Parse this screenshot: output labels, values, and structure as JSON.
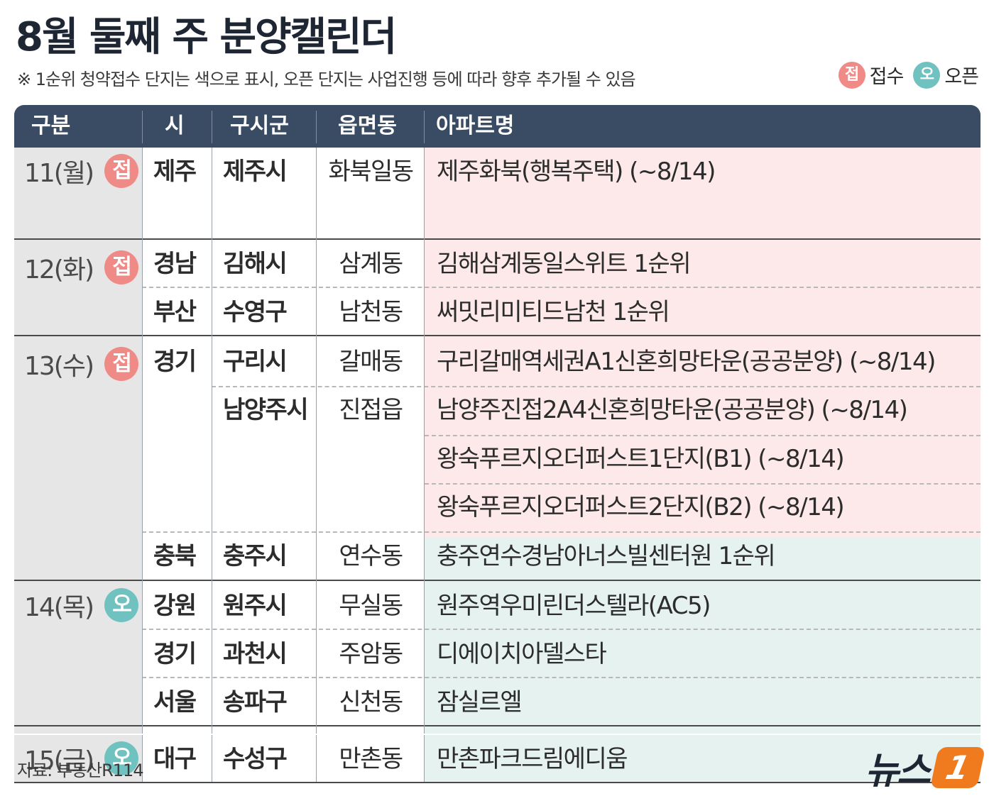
{
  "title": "8월 둘째 주 분양캘린더",
  "note": "※ 1순위 청약접수 단지는 색으로  표시, 오픈 단지는 사업진행 등에 따라 향후 추가될 수 있음",
  "legend": {
    "receipt_badge": "접",
    "receipt_label": "접수",
    "open_badge": "오",
    "open_label": "오픈"
  },
  "colors": {
    "header_bg": "#3a4b64",
    "receipt_badge": "#ef8a86",
    "open_badge": "#6fc2c0",
    "receipt_row": "#fde9e9",
    "open_row": "#e6f2f0",
    "date_cell": "#e6e6e6",
    "logo": "#f07a1e"
  },
  "table": {
    "headers": [
      "구분",
      "시",
      "구시군",
      "읍면동",
      "아파트명"
    ],
    "days": [
      {
        "date": "11(월)",
        "badge": "접",
        "rows": [
          {
            "si": "제주",
            "gu": "제주시",
            "dong": "화북일동",
            "apt": "제주화북(행복주택) (~8/14)"
          }
        ]
      },
      {
        "date": "12(화)",
        "badge": "접",
        "rows": [
          {
            "si": "경남",
            "gu": "김해시",
            "dong": "삼계동",
            "apt": "김해삼계동일스위트 1순위"
          },
          {
            "si": "부산",
            "gu": "수영구",
            "dong": "남천동",
            "apt": "써밋리미티드남천 1순위"
          }
        ]
      },
      {
        "date": "13(수)",
        "badge": "접",
        "rows": [
          {
            "si": "경기",
            "gu": "구리시",
            "dong": "갈매동",
            "apt": "구리갈매역세권A1신혼희망타운(공공분양) (~8/14)"
          },
          {
            "si": "",
            "gu": "남양주시",
            "dong": "진접읍",
            "apt": "남양주진접2A4신혼희망타운(공공분양) (~8/14)"
          },
          {
            "si": "",
            "gu": "",
            "dong": "",
            "apt": "왕숙푸르지오더퍼스트1단지(B1) (~8/14)"
          },
          {
            "si": "",
            "gu": "",
            "dong": "",
            "apt": "왕숙푸르지오더퍼스트2단지(B2) (~8/14)"
          },
          {
            "si": "충북",
            "gu": "충주시",
            "dong": "연수동",
            "apt": "충주연수경남아너스빌센터원 1순위"
          }
        ]
      },
      {
        "date": "14(목)",
        "badge": "오",
        "rows": [
          {
            "si": "강원",
            "gu": "원주시",
            "dong": "무실동",
            "apt": "원주역우미린더스텔라(AC5)"
          },
          {
            "si": "경기",
            "gu": "과천시",
            "dong": "주암동",
            "apt": "디에이치아델스타"
          },
          {
            "si": "서울",
            "gu": "송파구",
            "dong": "신천동",
            "apt": "잠실르엘"
          }
        ]
      },
      {
        "date": "15(금)",
        "badge": "오",
        "rows": [
          {
            "si": "대구",
            "gu": "수성구",
            "dong": "만촌동",
            "apt": "만촌파크드림에디움"
          }
        ]
      }
    ]
  },
  "source": "자료: 부동산R114",
  "logo": {
    "text": "뉴스",
    "mark": "1"
  }
}
